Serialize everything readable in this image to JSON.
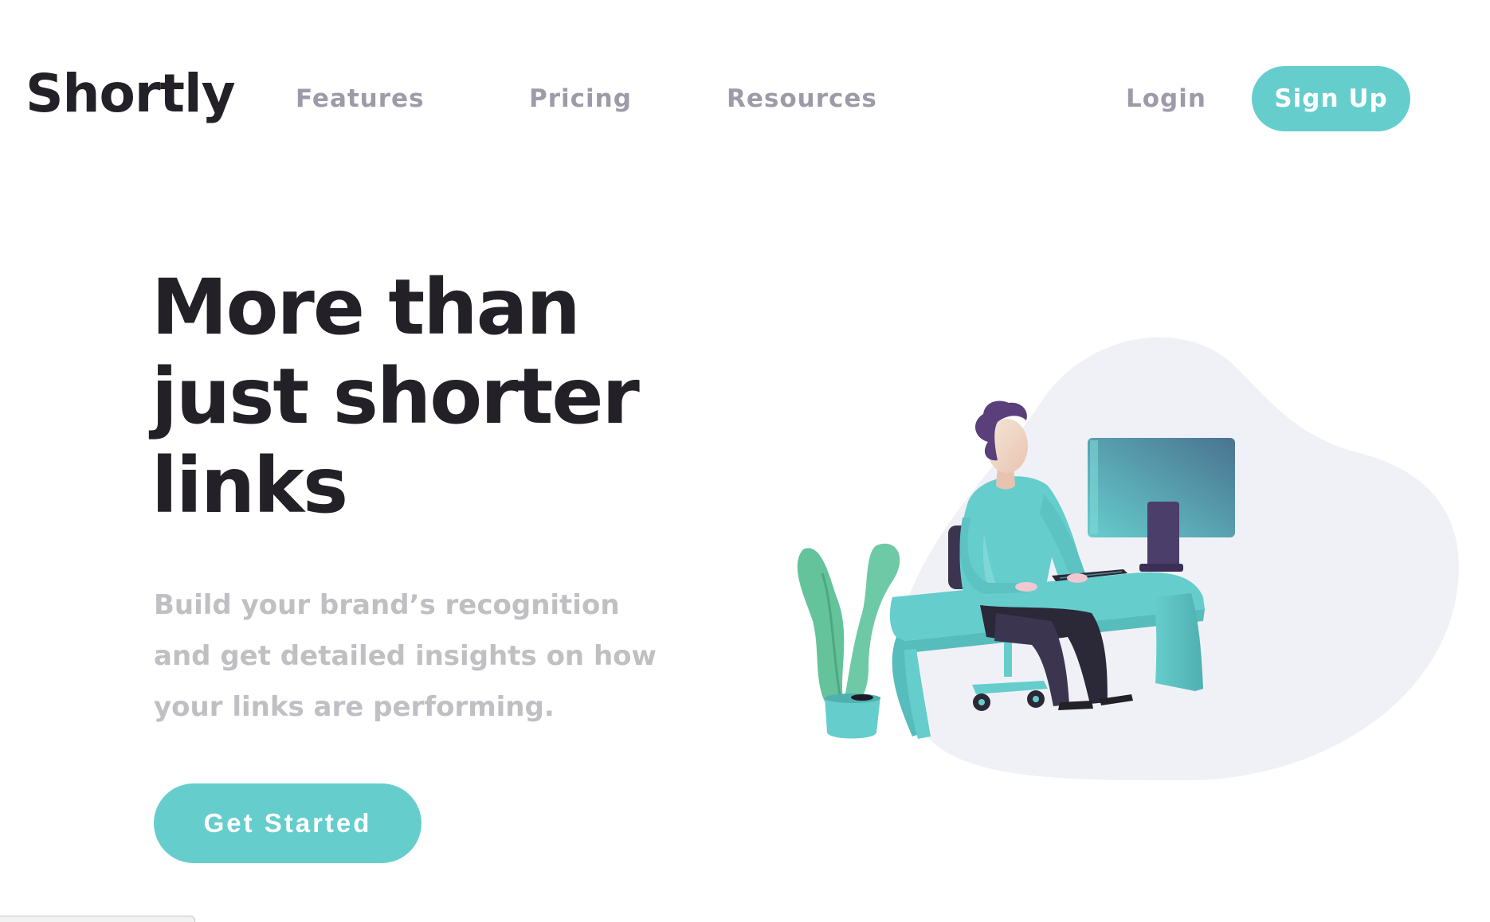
{
  "header": {
    "logo": "Shortly",
    "nav": {
      "features": "Features",
      "pricing": "Pricing",
      "resources": "Resources"
    },
    "login": "Login",
    "signup": "Sign Up"
  },
  "hero": {
    "title_lines": [
      "More than",
      "just shorter",
      "links"
    ],
    "description_lines": [
      "Build your brand’s recognition",
      "and get detailed insights on how",
      "your links are performing."
    ],
    "cta": "Get Started"
  },
  "colors": {
    "accent": "#66cdcd",
    "heading": "#232127",
    "nav_text": "#9e9aa8",
    "body_text": "#bfbfc4",
    "blob": "#f0f1f6"
  },
  "illustration": "person-working-at-desk-illustration"
}
